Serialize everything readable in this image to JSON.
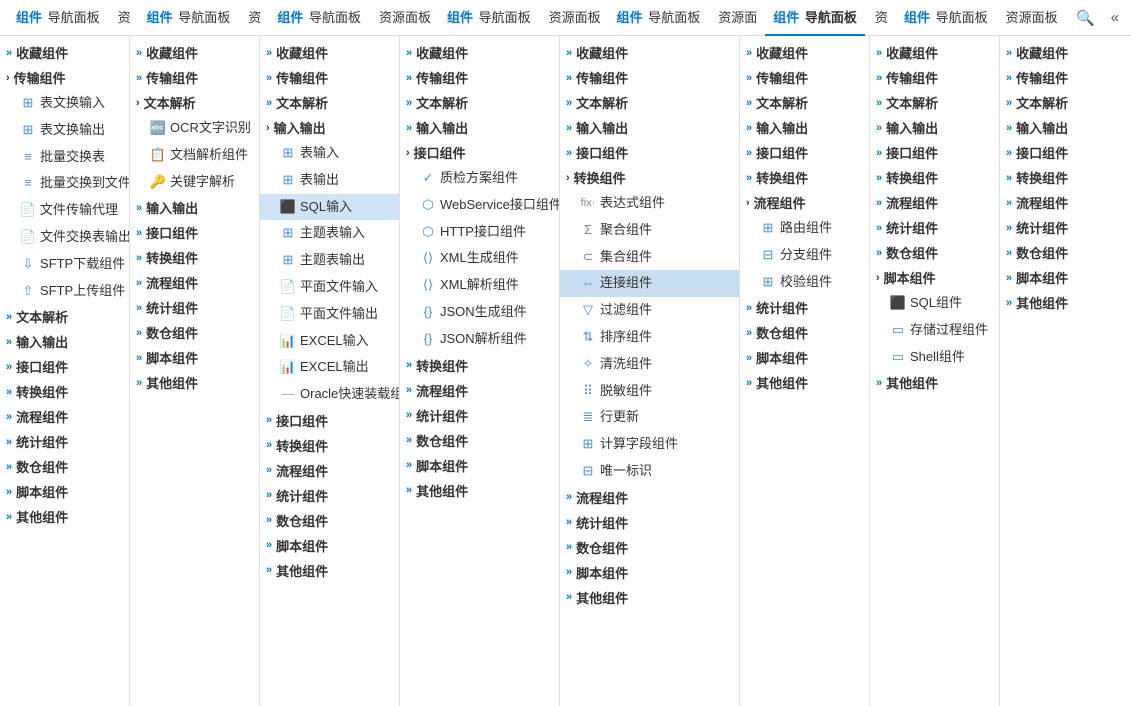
{
  "nav": {
    "tabs": [
      {
        "id": "t1",
        "main": "组件",
        "sub": "导航面板",
        "active": false
      },
      {
        "id": "t2",
        "main": "资",
        "sub": "",
        "active": false
      },
      {
        "id": "t3",
        "main": "组件",
        "sub": "导航面板",
        "active": false
      },
      {
        "id": "t4",
        "main": "资",
        "sub": "",
        "active": false
      },
      {
        "id": "t5",
        "main": "组件",
        "sub": "导航面板",
        "active": false
      },
      {
        "id": "t6",
        "main": "资源面板",
        "sub": "",
        "active": false
      },
      {
        "id": "t7",
        "main": "组件",
        "sub": "导航面板",
        "active": false
      },
      {
        "id": "t8",
        "main": "资源面板",
        "sub": "",
        "active": false
      },
      {
        "id": "t9",
        "main": "组件",
        "sub": "导航面板",
        "active": false
      },
      {
        "id": "t10",
        "main": "资源面",
        "sub": "",
        "active": false
      },
      {
        "id": "t11",
        "main": "组件",
        "sub": "导航面板",
        "active": true
      },
      {
        "id": "t12",
        "main": "资",
        "sub": "",
        "active": false
      },
      {
        "id": "t13",
        "main": "组件",
        "sub": "导航面板",
        "active": false
      },
      {
        "id": "t14",
        "main": "资源面板",
        "sub": "",
        "active": false
      }
    ],
    "search_icon": "🔍",
    "collapse_icon": "«"
  },
  "col1": {
    "items": [
      {
        "label": "收藏组件",
        "type": "section",
        "arrow": "»"
      },
      {
        "label": "传输组件",
        "type": "section",
        "arrow": "›",
        "expanded": true
      },
      {
        "label": "表文换输入",
        "type": "item",
        "icon": "table"
      },
      {
        "label": "表文换输出",
        "type": "item",
        "icon": "table"
      },
      {
        "label": "批量交换表",
        "type": "item",
        "icon": "batch"
      },
      {
        "label": "批量交换到文件",
        "type": "item",
        "icon": "batch"
      },
      {
        "label": "文件传输代理",
        "type": "item",
        "icon": "file"
      },
      {
        "label": "文件交换表输出",
        "type": "item",
        "icon": "file"
      },
      {
        "label": "SFTP下载组件",
        "type": "item",
        "icon": "sftp"
      },
      {
        "label": "SFTP上传组件",
        "type": "item",
        "icon": "sftp"
      },
      {
        "label": "文本解析",
        "type": "section",
        "arrow": "»"
      },
      {
        "label": "输入输出",
        "type": "section",
        "arrow": "»"
      },
      {
        "label": "接口组件",
        "type": "section",
        "arrow": "»"
      },
      {
        "label": "转换组件",
        "type": "section",
        "arrow": "»"
      },
      {
        "label": "流程组件",
        "type": "section",
        "arrow": "»"
      },
      {
        "label": "统计组件",
        "type": "section",
        "arrow": "»"
      },
      {
        "label": "数仓组件",
        "type": "section",
        "arrow": "»"
      },
      {
        "label": "脚本组件",
        "type": "section",
        "arrow": "»"
      },
      {
        "label": "其他组件",
        "type": "section",
        "arrow": "»"
      }
    ]
  },
  "col2": {
    "items": [
      {
        "label": "收藏组件",
        "type": "section",
        "arrow": "»"
      },
      {
        "label": "传输组件",
        "type": "section",
        "arrow": "»"
      },
      {
        "label": "文本解析",
        "type": "section",
        "arrow": "›",
        "expanded": true
      },
      {
        "label": "OCR文字识别",
        "type": "item",
        "icon": "ocr"
      },
      {
        "label": "文档解析组件",
        "type": "item",
        "icon": "doc"
      },
      {
        "label": "关键字解析",
        "type": "item",
        "icon": "key"
      },
      {
        "label": "输入输出",
        "type": "section",
        "arrow": "»"
      },
      {
        "label": "接口组件",
        "type": "section",
        "arrow": "»"
      },
      {
        "label": "转换组件",
        "type": "section",
        "arrow": "»"
      },
      {
        "label": "流程组件",
        "type": "section",
        "arrow": "»"
      },
      {
        "label": "统计组件",
        "type": "section",
        "arrow": "»"
      },
      {
        "label": "数仓组件",
        "type": "section",
        "arrow": "»"
      },
      {
        "label": "脚本组件",
        "type": "section",
        "arrow": "»"
      },
      {
        "label": "其他组件",
        "type": "section",
        "arrow": "»"
      }
    ]
  },
  "col3": {
    "items": [
      {
        "label": "收藏组件",
        "type": "section",
        "arrow": "»"
      },
      {
        "label": "传输组件",
        "type": "section",
        "arrow": "»"
      },
      {
        "label": "文本解析",
        "type": "section",
        "arrow": "»"
      },
      {
        "label": "输入输出",
        "type": "section",
        "arrow": "›",
        "expanded": true
      },
      {
        "label": "表输入",
        "type": "item",
        "icon": "table"
      },
      {
        "label": "表输出",
        "type": "item",
        "icon": "table"
      },
      {
        "label": "SQL输入",
        "type": "item",
        "icon": "sql",
        "selected": true
      },
      {
        "label": "主题表输入",
        "type": "item",
        "icon": "table"
      },
      {
        "label": "主题表输出",
        "type": "item",
        "icon": "table"
      },
      {
        "label": "平面文件输入",
        "type": "item",
        "icon": "file"
      },
      {
        "label": "平面文件输出",
        "type": "item",
        "icon": "file"
      },
      {
        "label": "EXCEL输入",
        "type": "item",
        "icon": "file"
      },
      {
        "label": "EXCEL输出",
        "type": "item",
        "icon": "file"
      },
      {
        "label": "Oracle快速装载组件",
        "type": "item",
        "icon": "dashed"
      },
      {
        "label": "接口组件",
        "type": "section",
        "arrow": "»"
      },
      {
        "label": "转换组件",
        "type": "section",
        "arrow": "»"
      },
      {
        "label": "流程组件",
        "type": "section",
        "arrow": "»"
      },
      {
        "label": "统计组件",
        "type": "section",
        "arrow": "»"
      },
      {
        "label": "数仓组件",
        "type": "section",
        "arrow": "»"
      },
      {
        "label": "脚本组件",
        "type": "section",
        "arrow": "»"
      },
      {
        "label": "其他组件",
        "type": "section",
        "arrow": "»"
      }
    ]
  },
  "col4": {
    "items": [
      {
        "label": "收藏组件",
        "type": "section",
        "arrow": "»"
      },
      {
        "label": "传输组件",
        "type": "section",
        "arrow": "»"
      },
      {
        "label": "文本解析",
        "type": "section",
        "arrow": "»"
      },
      {
        "label": "输入输出",
        "type": "section",
        "arrow": "»"
      },
      {
        "label": "接口组件",
        "type": "section",
        "arrow": "›",
        "expanded": true
      },
      {
        "label": "质检方案组件",
        "type": "item",
        "icon": "quality"
      },
      {
        "label": "WebService接口组件",
        "type": "item",
        "icon": "webservice"
      },
      {
        "label": "HTTP接口组件",
        "type": "item",
        "icon": "http"
      },
      {
        "label": "XML生成组件",
        "type": "item",
        "icon": "xml"
      },
      {
        "label": "XML解析组件",
        "type": "item",
        "icon": "xml"
      },
      {
        "label": "JSON生成组件",
        "type": "item",
        "icon": "json"
      },
      {
        "label": "JSON解析组件",
        "type": "item",
        "icon": "json"
      },
      {
        "label": "转换组件",
        "type": "section",
        "arrow": "»"
      },
      {
        "label": "流程组件",
        "type": "section",
        "arrow": "»"
      },
      {
        "label": "统计组件",
        "type": "section",
        "arrow": "»"
      },
      {
        "label": "数仓组件",
        "type": "section",
        "arrow": "»"
      },
      {
        "label": "脚本组件",
        "type": "section",
        "arrow": "»"
      },
      {
        "label": "其他组件",
        "type": "section",
        "arrow": "»"
      }
    ]
  },
  "col5": {
    "items": [
      {
        "label": "收藏组件",
        "type": "section",
        "arrow": "»"
      },
      {
        "label": "传输组件",
        "type": "section",
        "arrow": "»"
      },
      {
        "label": "文本解析",
        "type": "section",
        "arrow": "»"
      },
      {
        "label": "输入输出",
        "type": "section",
        "arrow": "»"
      },
      {
        "label": "接口组件",
        "type": "section",
        "arrow": "»"
      },
      {
        "label": "转换组件",
        "type": "section",
        "arrow": "›",
        "expanded": true
      },
      {
        "label": "表达式组件",
        "type": "item",
        "icon": "formula"
      },
      {
        "label": "聚合组件",
        "type": "item",
        "icon": "aggregate"
      },
      {
        "label": "集合组件",
        "type": "item",
        "icon": "collect"
      },
      {
        "label": "连接组件",
        "type": "item",
        "icon": "connect",
        "selected": true
      },
      {
        "label": "过滤组件",
        "type": "item",
        "icon": "filter"
      },
      {
        "label": "排序组件",
        "type": "item",
        "icon": "sort"
      },
      {
        "label": "清洗组件",
        "type": "item",
        "icon": "clean"
      },
      {
        "label": "脱敏组件",
        "type": "item",
        "icon": "defrag"
      },
      {
        "label": "行更新",
        "type": "item",
        "icon": "row"
      },
      {
        "label": "计算字段组件",
        "type": "item",
        "icon": "calc"
      },
      {
        "label": "唯一标识",
        "type": "item",
        "icon": "unique"
      },
      {
        "label": "流程组件",
        "type": "section",
        "arrow": "»"
      },
      {
        "label": "统计组件",
        "type": "section",
        "arrow": "»"
      },
      {
        "label": "数仓组件",
        "type": "section",
        "arrow": "»"
      },
      {
        "label": "脚本组件",
        "type": "section",
        "arrow": "»"
      },
      {
        "label": "其他组件",
        "type": "section",
        "arrow": "»"
      }
    ]
  },
  "col6": {
    "items": [
      {
        "label": "收藏组件",
        "type": "section",
        "arrow": "»"
      },
      {
        "label": "传输组件",
        "type": "section",
        "arrow": "»"
      },
      {
        "label": "文本解析",
        "type": "section",
        "arrow": "»"
      },
      {
        "label": "输入输出",
        "type": "section",
        "arrow": "»"
      },
      {
        "label": "接口组件",
        "type": "section",
        "arrow": "»"
      },
      {
        "label": "转换组件",
        "type": "section",
        "arrow": "»"
      },
      {
        "label": "流程组件",
        "type": "section",
        "arrow": "›",
        "expanded": true
      },
      {
        "label": "路由组件",
        "type": "item",
        "icon": "road"
      },
      {
        "label": "分支组件",
        "type": "item",
        "icon": "branch"
      },
      {
        "label": "校验组件",
        "type": "item",
        "icon": "check"
      },
      {
        "label": "统计组件",
        "type": "section",
        "arrow": "»"
      },
      {
        "label": "数仓组件",
        "type": "section",
        "arrow": "»"
      },
      {
        "label": "脚本组件",
        "type": "section",
        "arrow": "»"
      },
      {
        "label": "其他组件",
        "type": "section",
        "arrow": "»"
      }
    ]
  },
  "col7": {
    "items": [
      {
        "label": "收藏组件",
        "type": "section",
        "arrow": "»"
      },
      {
        "label": "传输组件",
        "type": "section",
        "arrow": "»"
      },
      {
        "label": "文本解析",
        "type": "section",
        "arrow": "»"
      },
      {
        "label": "输入输出",
        "type": "section",
        "arrow": "»"
      },
      {
        "label": "接口组件",
        "type": "section",
        "arrow": "»"
      },
      {
        "label": "转换组件",
        "type": "section",
        "arrow": "»"
      },
      {
        "label": "流程组件",
        "type": "section",
        "arrow": "»"
      },
      {
        "label": "统计组件",
        "type": "section",
        "arrow": "»"
      },
      {
        "label": "数仓组件",
        "type": "section",
        "arrow": "»"
      },
      {
        "label": "脚本组件",
        "type": "section",
        "arrow": "›",
        "expanded": true
      },
      {
        "label": "SQL组件",
        "type": "item",
        "icon": "sql2"
      },
      {
        "label": "存储过程组件",
        "type": "item",
        "icon": "store"
      },
      {
        "label": "Shell组件",
        "type": "item",
        "icon": "shell"
      },
      {
        "label": "其他组件",
        "type": "section",
        "arrow": "»"
      }
    ]
  },
  "col8": {
    "items": [
      {
        "label": "收藏组件",
        "type": "section",
        "arrow": "»"
      },
      {
        "label": "传输组件",
        "type": "section",
        "arrow": "»"
      },
      {
        "label": "文本解析",
        "type": "section",
        "arrow": "»"
      },
      {
        "label": "输入输出",
        "type": "section",
        "arrow": "»"
      },
      {
        "label": "接口组件",
        "type": "section",
        "arrow": "»"
      },
      {
        "label": "转换组件",
        "type": "section",
        "arrow": "»"
      },
      {
        "label": "流程组件",
        "type": "section",
        "arrow": "»"
      },
      {
        "label": "统计组件",
        "type": "section",
        "arrow": "»"
      },
      {
        "label": "数仓组件",
        "type": "section",
        "arrow": "»"
      },
      {
        "label": "脚本组件",
        "type": "section",
        "arrow": "»"
      },
      {
        "label": "其他组件",
        "type": "section",
        "arrow": "»"
      }
    ]
  }
}
